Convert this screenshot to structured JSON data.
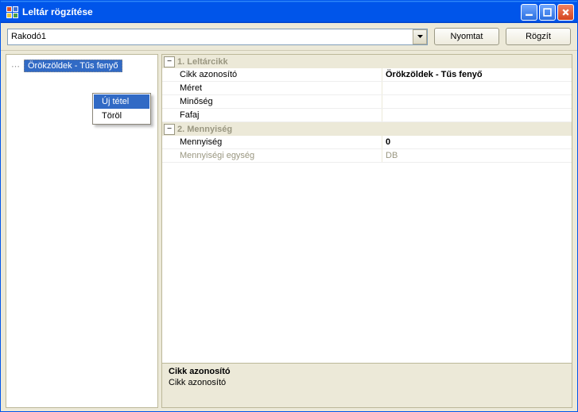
{
  "window": {
    "title": "Leltár rögzítése"
  },
  "toolbar": {
    "combo_value": "Rakodó1",
    "print_label": "Nyomtat",
    "save_label": "Rögzít"
  },
  "tree": {
    "selected_node": "Örökzöldek - Tűs fenyő"
  },
  "context_menu": {
    "new_item": "Új tétel",
    "delete": "Töröl"
  },
  "props": {
    "group1": {
      "title": "1. Leltárcikk"
    },
    "cikk_id": {
      "label": "Cikk azonosító",
      "value": "Örökzöldek - Tűs fenyő"
    },
    "meret": {
      "label": "Méret",
      "value": ""
    },
    "minoseg": {
      "label": "Minőség",
      "value": ""
    },
    "fafaj": {
      "label": "Fafaj",
      "value": ""
    },
    "group2": {
      "title": "2. Mennyiség"
    },
    "mennyiseg": {
      "label": "Mennyiség",
      "value": "0"
    },
    "egyseg": {
      "label": "Mennyiségi egység",
      "value": "DB"
    }
  },
  "help": {
    "title": "Cikk azonosító",
    "desc": "Cikk azonosító"
  }
}
